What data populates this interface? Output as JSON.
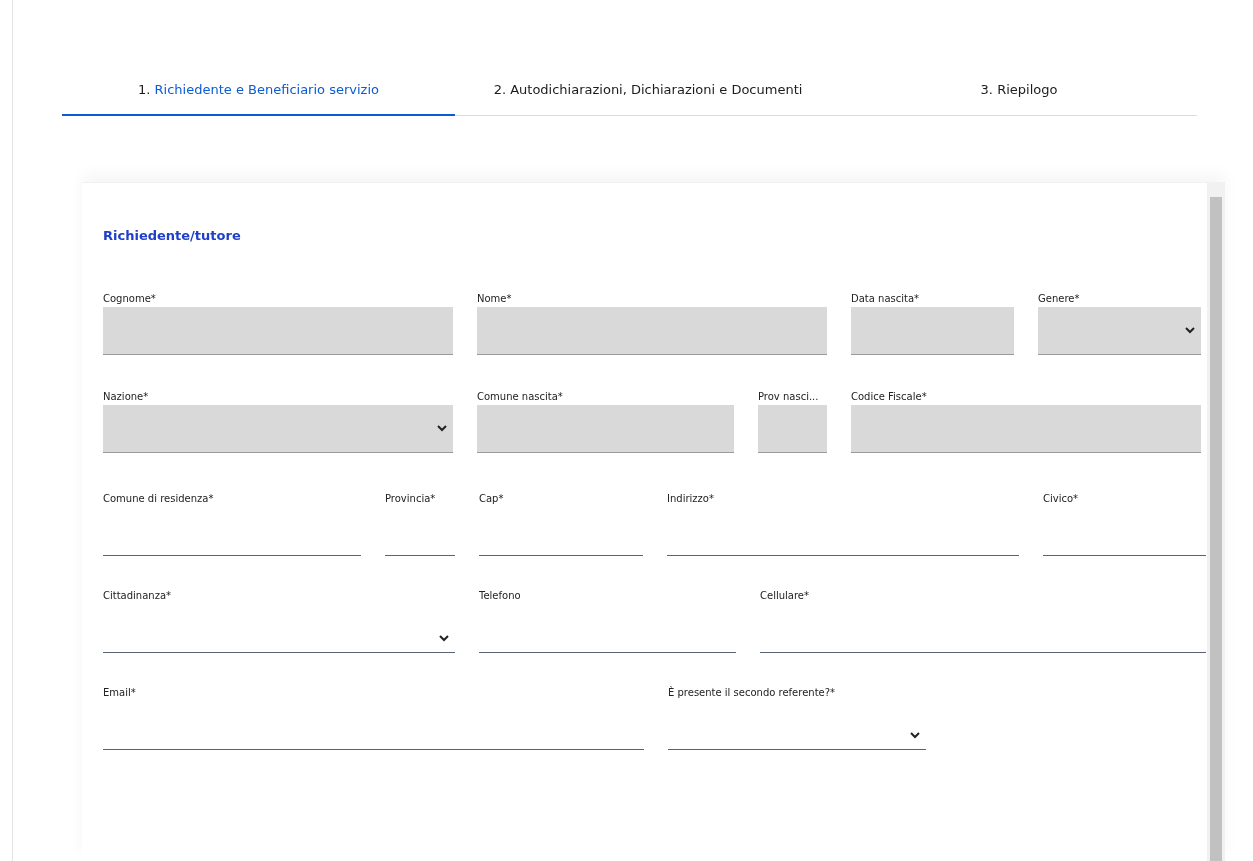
{
  "tabs": [
    {
      "number": "1.",
      "label": "Richiedente e Beneficiario servizio",
      "selected": true
    },
    {
      "number": "2.",
      "label": "Autodichiarazioni, Dichiarazioni e Documenti",
      "selected": false
    },
    {
      "number": "3.",
      "label": "Riepilogo",
      "selected": false
    }
  ],
  "section": {
    "title": "Richiedente/tutore",
    "rows": [
      {
        "fields": [
          {
            "label": "Cognome*",
            "kind": "text",
            "disabled": true
          },
          {
            "label": "Nome*",
            "kind": "text",
            "disabled": true
          },
          {
            "label": "Data nascita*",
            "kind": "text",
            "disabled": true
          },
          {
            "label": "Genere*",
            "kind": "select",
            "disabled": true
          }
        ]
      },
      {
        "fields": [
          {
            "label": "Nazione*",
            "kind": "select",
            "disabled": true
          },
          {
            "label": "Comune nascita*",
            "kind": "text",
            "disabled": true
          },
          {
            "label": "Prov nasci...",
            "kind": "text",
            "disabled": true
          },
          {
            "label": "Codice Fiscale*",
            "kind": "text",
            "disabled": true
          }
        ]
      },
      {
        "fields": [
          {
            "label": "Comune di residenza*",
            "kind": "text",
            "disabled": false
          },
          {
            "label": "Provincia*",
            "kind": "text",
            "disabled": false
          },
          {
            "label": "Cap*",
            "kind": "text",
            "disabled": false
          },
          {
            "label": "Indirizzo*",
            "kind": "text",
            "disabled": false
          },
          {
            "label": "Civico*",
            "kind": "text",
            "disabled": false
          }
        ]
      },
      {
        "fields": [
          {
            "label": "Cittadinanza*",
            "kind": "select",
            "disabled": false
          },
          {
            "label": "Telefono",
            "kind": "text",
            "disabled": false
          },
          {
            "label": "Cellulare*",
            "kind": "text",
            "disabled": false
          }
        ]
      },
      {
        "fields": [
          {
            "label": "Email*",
            "kind": "text",
            "disabled": false
          },
          {
            "label": "È presente il secondo referente?*",
            "kind": "select",
            "disabled": false
          }
        ]
      }
    ]
  }
}
